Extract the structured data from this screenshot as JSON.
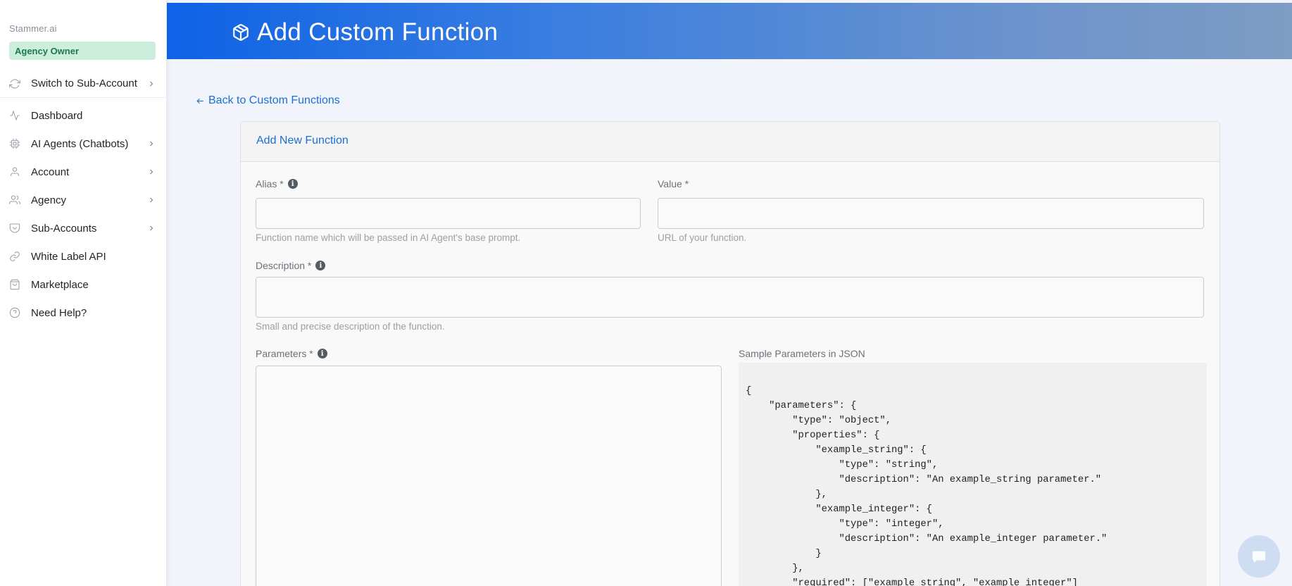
{
  "sidebar": {
    "brand": "Stammer.ai",
    "role_badge": "Agency Owner",
    "items": [
      {
        "label": "Switch to Sub-Account",
        "icon": "refresh-icon",
        "chevron": true
      },
      {
        "label": "Dashboard",
        "icon": "activity-icon",
        "chevron": false
      },
      {
        "label": "AI Agents (Chatbots)",
        "icon": "cpu-icon",
        "chevron": true
      },
      {
        "label": "Account",
        "icon": "user-icon",
        "chevron": true
      },
      {
        "label": "Agency",
        "icon": "users-icon",
        "chevron": true
      },
      {
        "label": "Sub-Accounts",
        "icon": "pocket-icon",
        "chevron": true
      },
      {
        "label": "White Label API",
        "icon": "link-icon",
        "chevron": false
      },
      {
        "label": "Marketplace",
        "icon": "shopping-bag-icon",
        "chevron": false
      },
      {
        "label": "Need Help?",
        "icon": "help-circle-icon",
        "chevron": false
      }
    ]
  },
  "header": {
    "title": "Add Custom Function",
    "icon": "package-icon"
  },
  "back_link": "Back to Custom Functions",
  "form": {
    "card_title": "Add New Function",
    "alias": {
      "label": "Alias *",
      "value": "",
      "help": "Function name which will be passed in AI Agent's base prompt."
    },
    "value": {
      "label": "Value *",
      "value": "",
      "help": "URL of your function."
    },
    "description": {
      "label": "Description *",
      "value": "",
      "help": "Small and precise description of the function."
    },
    "parameters": {
      "label": "Parameters *",
      "value": ""
    },
    "sample": {
      "label": "Sample Parameters in JSON",
      "code": "{\n    \"parameters\": {\n        \"type\": \"object\",\n        \"properties\": {\n            \"example_string\": {\n                \"type\": \"string\",\n                \"description\": \"An example_string parameter.\"\n            },\n            \"example_integer\": {\n                \"type\": \"integer\",\n                \"description\": \"An example_integer parameter.\"\n            }\n        },\n        \"required\": [\"example_string\", \"example_integer\"]"
    }
  },
  "colors": {
    "accent": "#1b6fd1",
    "header_start": "#0f62e6",
    "header_end": "#7e9cc4",
    "badge_bg": "#cdeedd",
    "badge_text": "#1a7a4c"
  }
}
